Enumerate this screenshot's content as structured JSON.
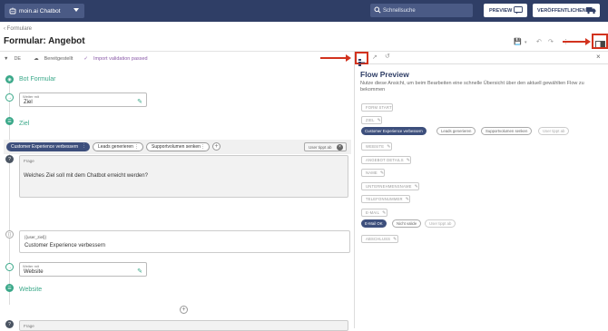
{
  "topbar": {
    "bot_name": "moin.ai Chatbot",
    "search_placeholder": "Schnellsuche",
    "preview_label": "PREVIEW",
    "publish_label": "VERÖFFENTLICHEN"
  },
  "breadcrumb": "Formulare",
  "page_title": "Formular: Angebot",
  "filterbar": {
    "language": "DE",
    "status": "Bereitgestellt",
    "validation": "Import validation passed"
  },
  "editor": {
    "bot_formular_title": "Bot Formular",
    "weiter_label": "Weiter mit",
    "weiter_ziel": "Ziel",
    "ziel_title": "Ziel",
    "frage_label": "Frage",
    "frage_text": "Welches Ziel soll mit dem Chatbot erreicht werden?",
    "options": [
      "Customer Experience verbessern",
      "Leads generieren",
      "Supportvolumen senken"
    ],
    "user_input_label": "User tippt ab",
    "var_label": "{{user_ziel}}",
    "var_value": "Customer Experience verbessern",
    "weiter_website": "Website",
    "website_title": "Website",
    "frage_label_2": "Frage"
  },
  "preview": {
    "title": "Flow Preview",
    "description": "Nutze diese Ansicht, um beim Bearbeiten eine schnelle Übersicht über den aktuell gewählten Flow zu bekommen",
    "form_start": "FORM START",
    "ziel": "ZIEL",
    "ziel_options": [
      "Customer Experience verbessern",
      "Leads generieren",
      "Supportvolumen senken",
      "User tippt ab"
    ],
    "fields": [
      "WEBSITE",
      "ANGEBOT DETAILS",
      "NAME",
      "UNTERNEHMENSNAME",
      "TELEFONNUMMER",
      "E-MAIL"
    ],
    "email_options": [
      "E-Mail OK",
      "Nicht valide",
      "User tippt ab"
    ],
    "abschluss": "ABSCHLUSS"
  },
  "colors": {
    "topbar": "#2f3e66",
    "accent_green": "#3aa889",
    "chip_active": "#3d4f7c",
    "annotation_red": "#d2321e"
  }
}
